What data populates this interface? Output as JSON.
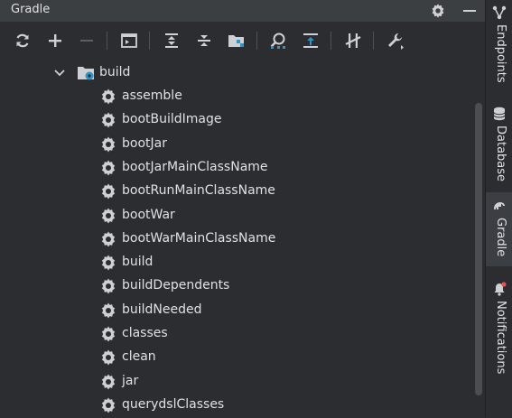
{
  "panel": {
    "title": "Gradle"
  },
  "header_icons": [
    "gear-icon",
    "minimize-icon"
  ],
  "toolbar": {
    "buttons": [
      "reload-icon",
      "add-icon",
      "remove-icon",
      "execute-task-icon",
      "expand-all-icon",
      "collapse-all-icon",
      "group-modules-icon",
      "analyze-dependencies-icon",
      "show-dependencies-icon",
      "toggle-offline-icon",
      "settings-wrench-icon"
    ]
  },
  "tree": {
    "folder": {
      "label": "build",
      "icon": "folder-gear-icon",
      "expanded": true
    },
    "tasks": [
      "assemble",
      "bootBuildImage",
      "bootJar",
      "bootJarMainClassName",
      "bootRunMainClassName",
      "bootWar",
      "bootWarMainClassName",
      "build",
      "buildDependents",
      "buildNeeded",
      "classes",
      "clean",
      "jar",
      "querydslClasses"
    ]
  },
  "sidebar": {
    "tabs": [
      {
        "label": "Endpoints",
        "icon": "endpoints-icon",
        "active": false
      },
      {
        "label": "Database",
        "icon": "database-icon",
        "active": false
      },
      {
        "label": "Gradle",
        "icon": "gradle-elephant-icon",
        "active": true
      },
      {
        "label": "Notifications",
        "icon": "bell-icon",
        "active": false
      }
    ]
  },
  "colors": {
    "background": "#2b2d30",
    "header": "#3c3f41",
    "accent_blue": "#3592c4",
    "text": "#dfe1e5",
    "icon_grey": "#ced0d6",
    "notification_dot": "#e55353"
  }
}
